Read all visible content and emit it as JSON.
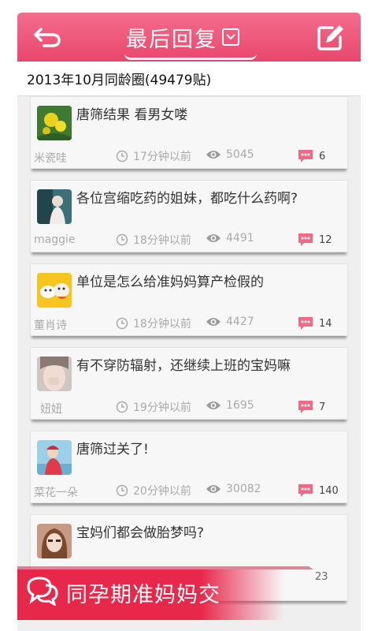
{
  "header": {
    "title": "最后回复",
    "back_icon": "back-arrow-icon",
    "edit_icon": "compose-icon",
    "accent": "#ec5477"
  },
  "subheader": {
    "text": "2013年10月同龄圈(49479贴)"
  },
  "posts": [
    {
      "title": "唐筛结果 看男女喽",
      "author": "米瓷哇",
      "time": "17分钟以前",
      "views": "5045",
      "replies": "6"
    },
    {
      "title": "各位宫缩吃药的姐妹，都吃什么药啊?",
      "author": "maggie",
      "time": "18分钟以前",
      "views": "4491",
      "replies": "12"
    },
    {
      "title": "单位是怎么给准妈妈算产检假的",
      "author": "董肖诗",
      "time": "18分钟以前",
      "views": "4427",
      "replies": "14"
    },
    {
      "title": "有不穿防辐射，还继续上班的宝妈嘛",
      "author": "妞妞",
      "time": "19分钟以前",
      "views": "1695",
      "replies": "7"
    },
    {
      "title": "唐筛过关了!",
      "author": "菜花一朵",
      "time": "20分钟以前",
      "views": "30082",
      "replies": "140"
    },
    {
      "title": "宝妈们都会做胎梦吗?",
      "author": "",
      "time": "",
      "views": "",
      "replies": "23"
    }
  ],
  "banner": {
    "text": "同孕期准妈妈交",
    "icon": "chat-bubbles-icon",
    "color": "#e8284a"
  }
}
